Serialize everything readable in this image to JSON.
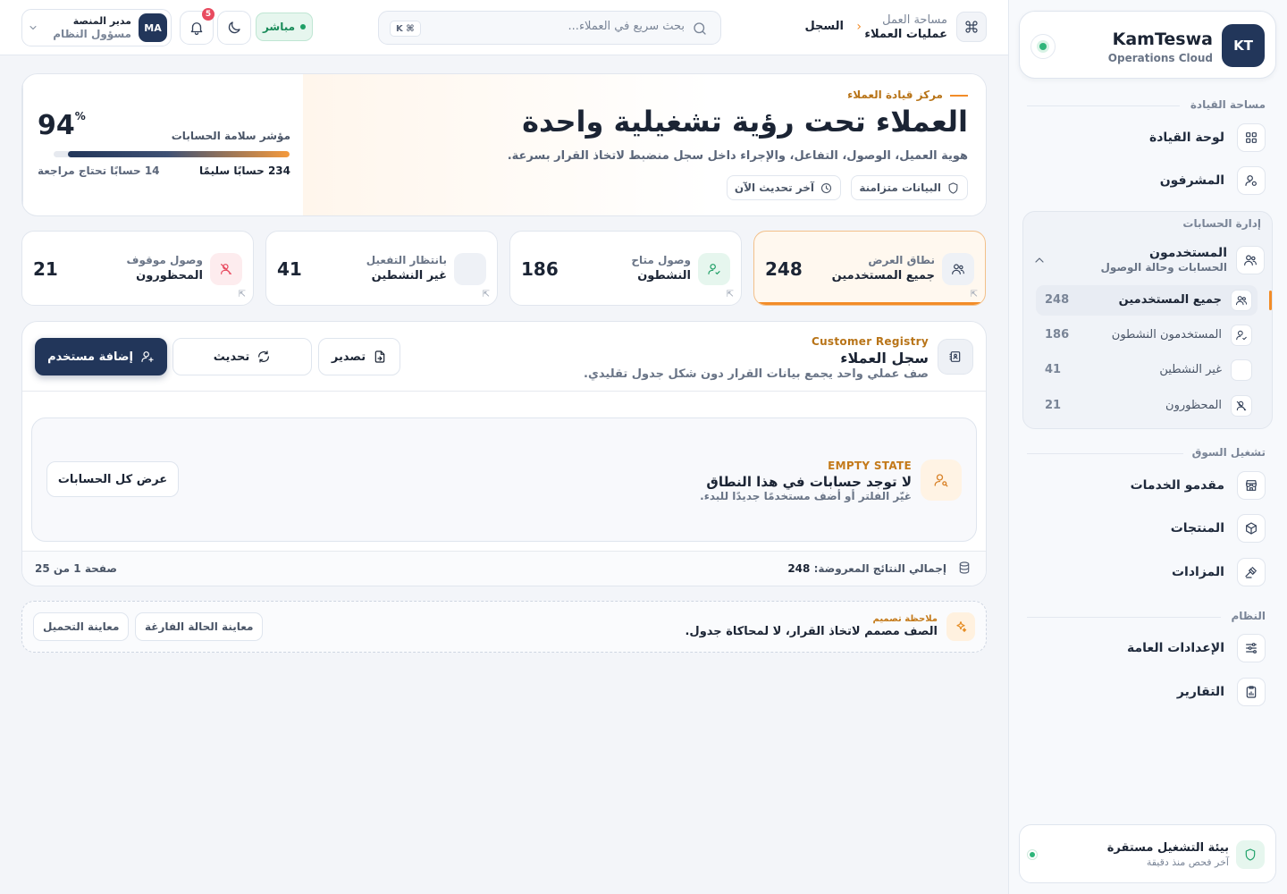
{
  "brand": {
    "initials": "KT",
    "name": "KamTeswa",
    "subtitle": "Operations Cloud"
  },
  "sidebar": {
    "section_command": "مساحة القيادة",
    "nav_dashboard": "لوحة القيادة",
    "nav_supervisors": "المشرفون",
    "section_accounts": "إدارة الحسابات",
    "users_title": "المستخدمون",
    "users_subtitle": "الحسابات وحالة الوصول",
    "sub_items": [
      {
        "label": "جميع المستخدمين",
        "count": "248"
      },
      {
        "label": "المستخدمون النشطون",
        "count": "186"
      },
      {
        "label": "غير النشطين",
        "count": "41"
      },
      {
        "label": "المحظورون",
        "count": "21"
      }
    ],
    "section_market": "تشغيل السوق",
    "nav_providers": "مقدمو الخدمات",
    "nav_products": "المنتجات",
    "nav_auctions": "المزادات",
    "section_system": "النظام",
    "nav_settings": "الإعدادات العامة",
    "nav_reports": "التقارير",
    "env_title": "بيئة التشغيل مستقرة",
    "env_sub": "آخر فحص منذ دقيقة"
  },
  "topbar": {
    "breadcrumb_parent": "مساحة العمل",
    "breadcrumb_section": "عمليات العملاء",
    "breadcrumb_current": "السجل",
    "search_placeholder": "بحث سريع في العملاء...",
    "shortcut": "⌘ K",
    "live_label": "مباشر",
    "notifications_count": "5",
    "user_role": "مدير المنصة",
    "user_title": "مسؤول النظام",
    "user_initials": "MA"
  },
  "hero": {
    "eyebrow": "مركز قيادة العملاء",
    "title": "العملاء تحت رؤية تشغيلية واحدة",
    "description": "هوية العميل، الوصول، التفاعل، والإجراء داخل سجل منضبط لاتخاذ القرار بسرعة.",
    "chip_synced": "البيانات متزامنة",
    "chip_updated": "آخر تحديث الآن",
    "health_title": "مؤشر سلامة الحسابات",
    "health_value": "94",
    "health_unit": "%",
    "health_progress": 0.94,
    "health_ok": "234 حسابًا سليمًا",
    "health_review": "14 حسابًا تحتاج مراجعة"
  },
  "stats": [
    {
      "label": "نطاق العرض",
      "title": "جميع المستخدمين",
      "value": "248",
      "icon": "users-icon"
    },
    {
      "label": "وصول متاح",
      "title": "النشطون",
      "value": "186",
      "icon": "user-check-icon"
    },
    {
      "label": "بانتظار التفعيل",
      "title": "غير النشطين",
      "value": "41",
      "icon": "blank-icon"
    },
    {
      "label": "وصول موقوف",
      "title": "المحظورون",
      "value": "21",
      "icon": "user-x-icon"
    }
  ],
  "registry": {
    "eyebrow": "Customer Registry",
    "title": "سجل العملاء",
    "description": "صف عملي واحد يجمع بيانات القرار دون شكل جدول تقليدي.",
    "export": "تصدير",
    "refresh": "تحديث",
    "add_user": "إضافة مستخدم",
    "empty_eyebrow": "EMPTY STATE",
    "empty_title": "لا توجد حسابات في هذا النطاق",
    "empty_desc": "غيّر الفلتر أو أضف مستخدمًا جديدًا للبدء.",
    "empty_button": "عرض كل الحسابات",
    "total_label": "إجمالي النتائج المعروضة:",
    "total_value": "248",
    "pagination": "صفحة 1 من 25"
  },
  "note": {
    "eyebrow": "ملاحظة تصميم",
    "text": "الصف مصمم لاتخاذ القرار، لا لمحاكاة جدول.",
    "preview_empty": "معاينة الحالة الفارغة",
    "preview_loading": "معاينة التحميل"
  },
  "colors": {
    "brand": "#22365a",
    "accent": "#f28c28",
    "success": "#2fb57a",
    "danger": "#e84a5f"
  }
}
